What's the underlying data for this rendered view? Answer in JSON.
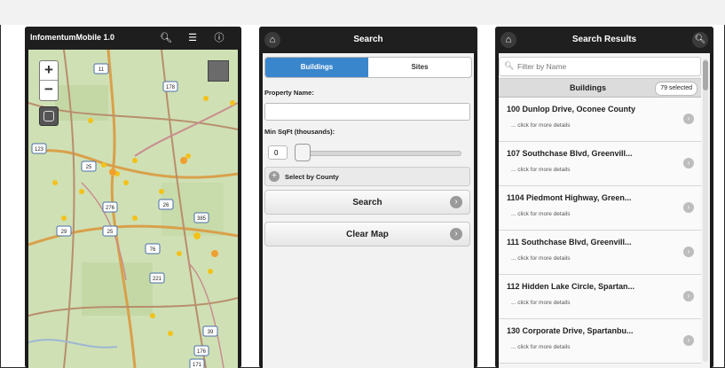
{
  "map_phone": {
    "title": "InfomentumMobile 1.0",
    "header_icons": [
      "search-icon",
      "menu-icon",
      "info-icon"
    ],
    "zoom_in": "+",
    "zoom_out": "−",
    "route_labels": [
      "11",
      "178",
      "123",
      "25",
      "276",
      "26",
      "29",
      "25",
      "76",
      "385",
      "221",
      "39",
      "176",
      "171"
    ]
  },
  "search_phone": {
    "header_title": "Search",
    "tabs": [
      {
        "label": "Buildings",
        "active": true
      },
      {
        "label": "Sites",
        "active": false
      }
    ],
    "property_name_label": "Property Name:",
    "property_name_value": "",
    "min_sqft_label": "Min SqFt (thousands):",
    "min_sqft_value": "0",
    "select_by_county": "Select by County",
    "search_button": "Search",
    "clear_map_button": "Clear Map"
  },
  "results_phone": {
    "header_title": "Search Results",
    "filter_placeholder": "Filter by Name",
    "group_title": "Buildings",
    "selected_badge": "79 selected",
    "items": [
      {
        "address": "100 Dunlop Drive, Oconee County",
        "details": "... click for more details"
      },
      {
        "address": "107 Southchase Blvd, Greenvill...",
        "details": "... click for more details"
      },
      {
        "address": "1104 Piedmont Highway, Green...",
        "details": "... click for more details"
      },
      {
        "address": "111 Southchase Blvd, Greenvill...",
        "details": "... click for more details"
      },
      {
        "address": "112 Hidden Lake Circle, Spartan...",
        "details": "... click for more details"
      },
      {
        "address": "130 Corporate Drive, Spartanbu...",
        "details": "... click for more details"
      }
    ]
  },
  "colors": {
    "accent_blue": "#3a86cc",
    "header_dark": "#1f1f1f",
    "map_base": "#cfe0b5"
  }
}
